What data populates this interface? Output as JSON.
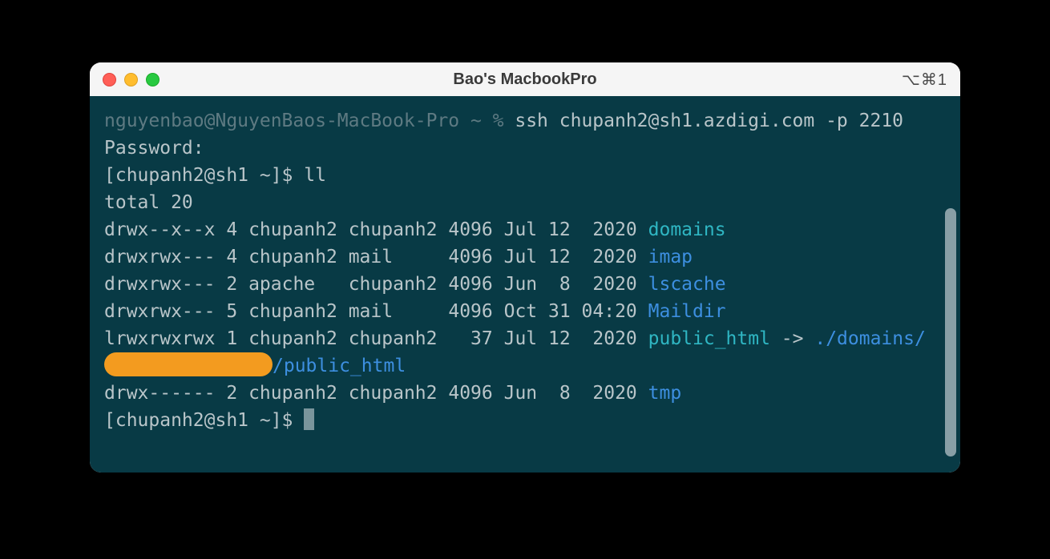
{
  "window": {
    "title": "Bao's MacbookPro",
    "shortcut": "⌥⌘1"
  },
  "colors": {
    "bg": "#083a45",
    "fg": "#b9c5c9",
    "gray": "#5e7a82",
    "cyan": "#2fb6c3",
    "blue": "#3d8fe0",
    "redact": "#f39b1f"
  },
  "prompt_local": "nguyenbao@NguyenBaos-MacBook-Pro ~ % ",
  "ssh_cmd": "ssh chupanh2@sh1.azdigi.com -p 2210",
  "password_label": "Password:",
  "prompt_remote": "[chupanh2@sh1 ~]$ ",
  "ll_cmd": "ll",
  "total_line": "total 20",
  "listing": [
    {
      "perm": "drwx--x--x",
      "links": "4",
      "owner": "chupanh2",
      "group": "chupanh2",
      "size": "4096",
      "date": "Jul 12  2020",
      "name": "domains",
      "name_color": "cyan"
    },
    {
      "perm": "drwxrwx---",
      "links": "4",
      "owner": "chupanh2",
      "group": "mail    ",
      "size": "4096",
      "date": "Jul 12  2020",
      "name": "imap",
      "name_color": "blue"
    },
    {
      "perm": "drwxrwx---",
      "links": "2",
      "owner": "apache  ",
      "group": "chupanh2",
      "size": "4096",
      "date": "Jun  8  2020",
      "name": "lscache",
      "name_color": "blue"
    },
    {
      "perm": "drwxrwx---",
      "links": "5",
      "owner": "chupanh2",
      "group": "mail    ",
      "size": "4096",
      "date": "Oct 31 04:20",
      "name": "Maildir",
      "name_color": "blue"
    }
  ],
  "symlink": {
    "perm": "lrwxrwxrwx",
    "links": "1",
    "owner": "chupanh2",
    "group": "chupanh2",
    "size": "  37",
    "date": "Jul 12  2020",
    "name": "public_html",
    "arrow": " -> ",
    "target_prefix": "./domains/",
    "target_suffix": "/public_html"
  },
  "last_row": {
    "perm": "drwx------",
    "links": "2",
    "owner": "chupanh2",
    "group": "chupanh2",
    "size": "4096",
    "date": "Jun  8  2020",
    "name": "tmp",
    "name_color": "blue"
  }
}
